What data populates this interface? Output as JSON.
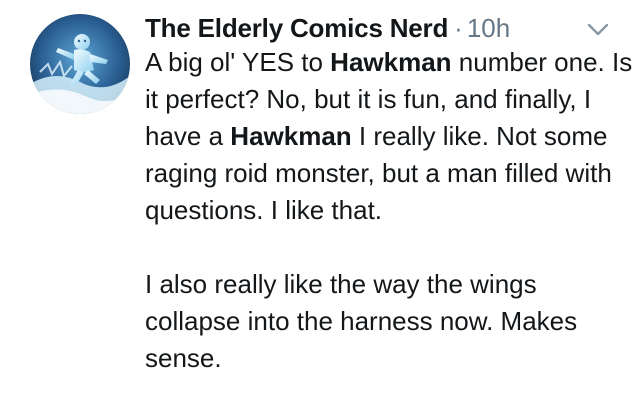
{
  "tweet": {
    "author": {
      "display_name": "The Elderly Comics Nerd",
      "avatar_icon": "iceman-avatar"
    },
    "separator": "·",
    "timestamp": "10h",
    "menu_icon": "chevron-down-icon",
    "paragraph1": {
      "t1": "A big ol' YES to ",
      "b1": "Hawkman",
      "t2": " number one. Is it perfect? No, but it is fun, and finally, I have a ",
      "b2": "Hawkman",
      "t3": " I really like. Not some raging roid monster, but a man filled with questions. I like that."
    },
    "paragraph2": "I also really like the way the wings collapse into the harness now. Makes sense.",
    "colors": {
      "text": "#14171a",
      "muted": "#657786",
      "avatar_bg": "#1c3f66",
      "avatar_ice": "#bfe6f7"
    }
  }
}
